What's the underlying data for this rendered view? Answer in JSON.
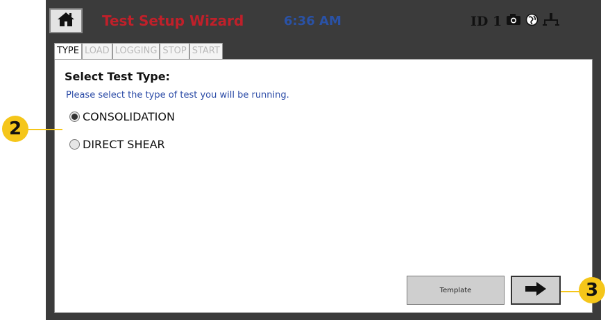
{
  "header": {
    "title": "Test Setup Wizard",
    "time": "6:36 AM",
    "device_id": "ID 1",
    "icons": [
      "home-icon",
      "camera-icon",
      "globe-icon",
      "network-icon"
    ]
  },
  "tabs": [
    {
      "label": "TYPE",
      "active": true
    },
    {
      "label": "LOAD",
      "active": false
    },
    {
      "label": "LOGGING",
      "active": false
    },
    {
      "label": "STOP",
      "active": false
    },
    {
      "label": "START",
      "active": false
    }
  ],
  "main": {
    "heading": "Select Test Type:",
    "instruction": "Please select the type of test you will be running.",
    "options": [
      {
        "label": "CONSOLIDATION",
        "selected": true
      },
      {
        "label": "DIRECT SHEAR",
        "selected": false
      }
    ]
  },
  "buttons": {
    "template_label": "Template",
    "next_icon": "arrow-right-icon"
  },
  "callouts": [
    "2",
    "3"
  ],
  "colors": {
    "frame": "#3b3b3b",
    "title": "#c0202a",
    "clock": "#2a52a6",
    "callout": "#f5c61a"
  }
}
